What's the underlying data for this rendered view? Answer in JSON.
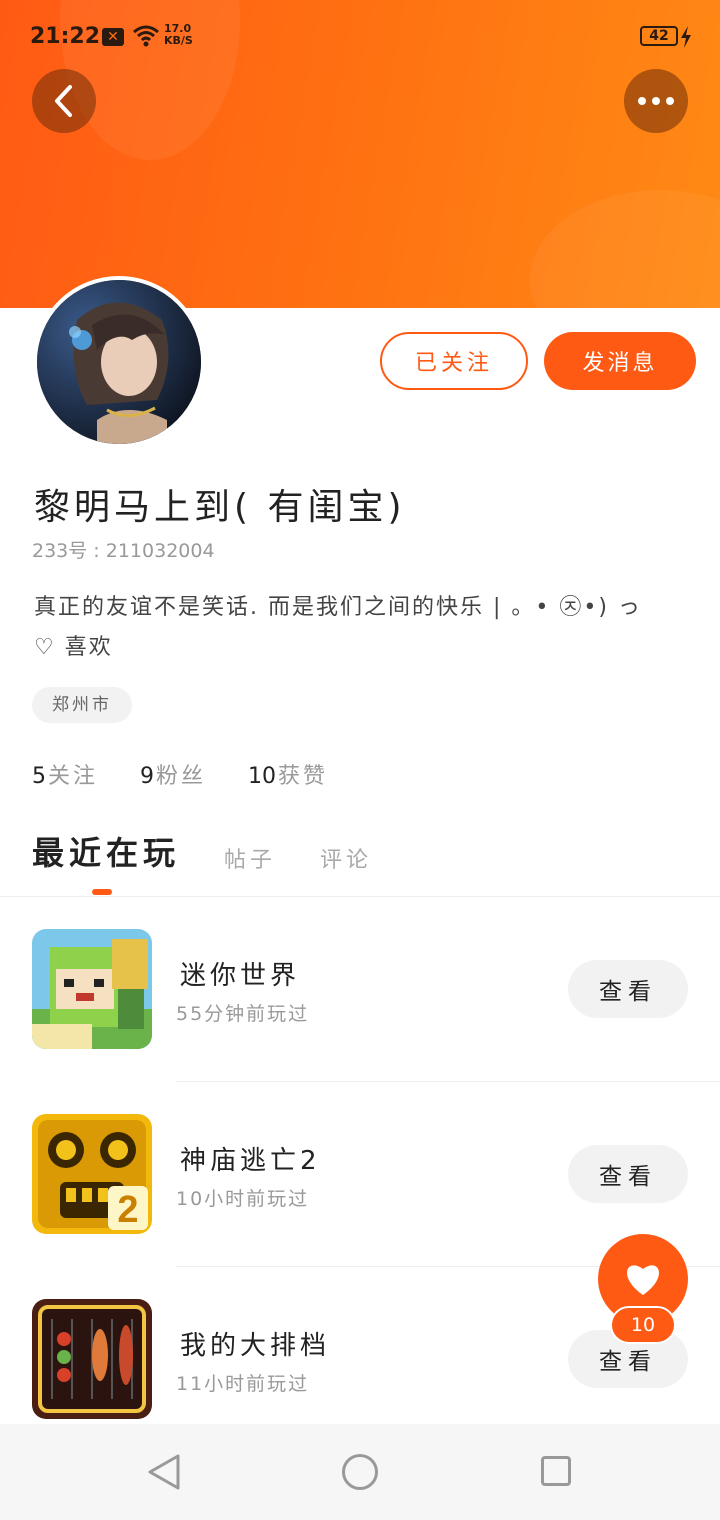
{
  "status_bar": {
    "time": "21:22",
    "x_badge": "✕",
    "speed_value": "17.0",
    "speed_unit": "KB/S",
    "battery": "42",
    "icons": [
      "notification-x-icon",
      "wifi-icon",
      "battery-icon",
      "charging-bolt-icon"
    ]
  },
  "header": {
    "back_icon": "chevron-left-icon",
    "more_icon": "more-dots-icon",
    "gradient_colors": [
      "#ff5a14",
      "#ff8a14"
    ]
  },
  "profile": {
    "nickname": "黎明马上到( 有闺宝)",
    "uid": "233号 : 211032004",
    "bio": "真正的友谊不是笑话. 而是我们之间的快乐 | 。• ㉨•) っ♡   喜欢",
    "location": "郑州市",
    "follow_label": "已关注",
    "message_label": "发消息"
  },
  "stats": [
    {
      "value": "5",
      "label": "关注"
    },
    {
      "value": "9",
      "label": "粉丝"
    },
    {
      "value": "10",
      "label": "获赞"
    }
  ],
  "tabs": [
    {
      "label": "最近在玩",
      "active": true
    },
    {
      "label": "帖子",
      "active": false
    },
    {
      "label": "评论",
      "active": false
    }
  ],
  "games": [
    {
      "name": "迷你世界",
      "time": "55分钟前玩过",
      "button": "查看",
      "icon": "mini-world-game-icon"
    },
    {
      "name": "神庙逃亡2",
      "time": "10小时前玩过",
      "button": "查看",
      "icon": "temple-run-2-game-icon"
    },
    {
      "name": "我的大排档",
      "time": "11小时前玩过",
      "button": "查看",
      "icon": "food-stall-game-icon"
    }
  ],
  "like_fab": {
    "count": "10",
    "icon": "heart-icon"
  },
  "nav": {
    "icons": [
      "nav-back-icon",
      "nav-home-icon",
      "nav-recent-icon"
    ]
  },
  "colors": {
    "accent": "#ff5a14",
    "text": "#222222",
    "muted": "#999999",
    "chip_bg": "#f2f2f2"
  }
}
